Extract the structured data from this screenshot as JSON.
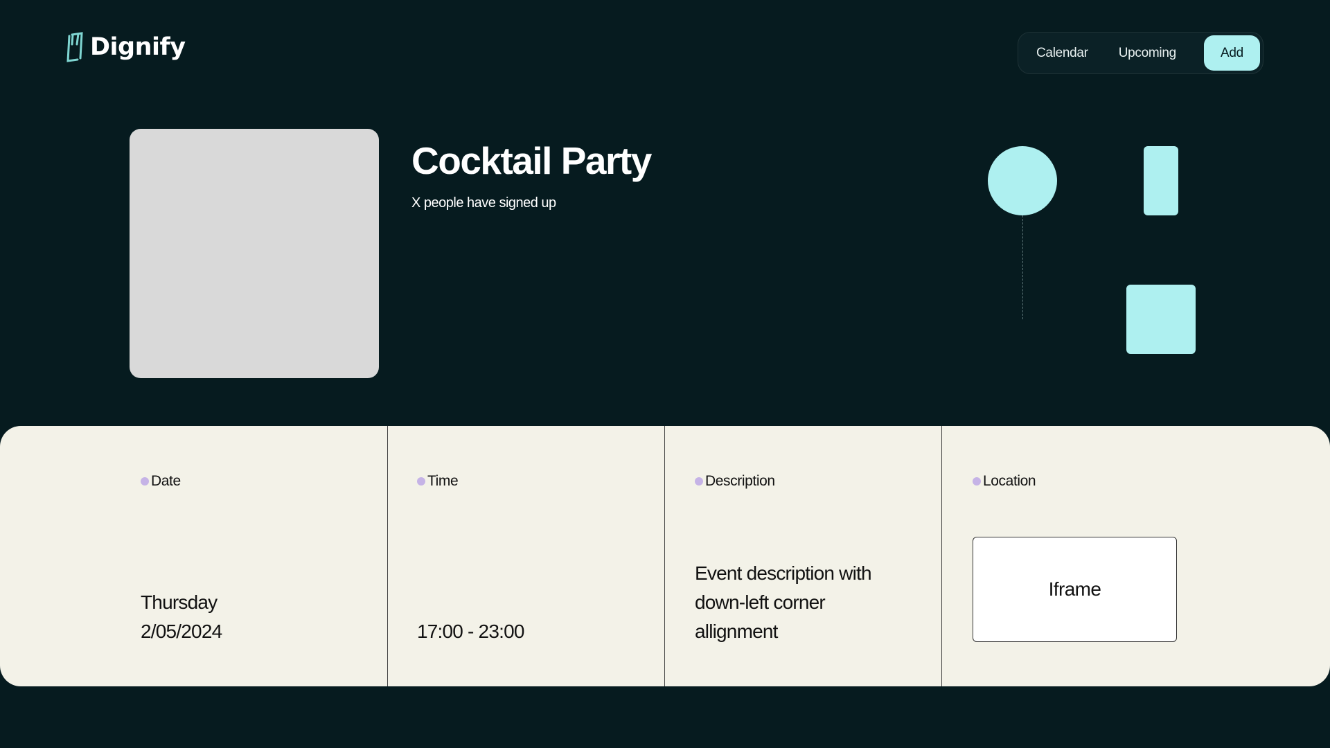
{
  "brand": {
    "name": "Dignify",
    "accent": "#aef0f0",
    "background": "#061b1f"
  },
  "nav": {
    "items": [
      "Calendar",
      "Upcoming"
    ],
    "add": "Add"
  },
  "event": {
    "title": "Cocktail Party",
    "subtitle": "X people have signed up"
  },
  "details": {
    "date": {
      "label": "Date",
      "day": "Thursday",
      "date": "2/05/2024"
    },
    "time": {
      "label": "Time",
      "value": "17:00 - 23:00"
    },
    "description": {
      "label": "Description",
      "lines": [
        "Event description with",
        "down-left corner",
        "allignment"
      ]
    },
    "location": {
      "label": "Location",
      "iframe": "Iframe"
    }
  }
}
